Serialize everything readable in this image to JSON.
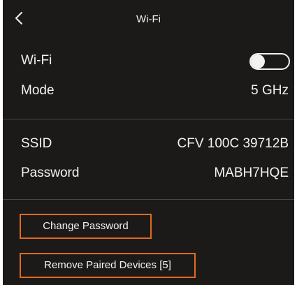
{
  "header": {
    "title": "Wi-Fi",
    "back_icon": "chevron-left-icon"
  },
  "wifi_section": {
    "wifi_label": "Wi-Fi",
    "wifi_enabled": false,
    "mode_label": "Mode",
    "mode_value": "5 GHz"
  },
  "network_section": {
    "ssid_label": "SSID",
    "ssid_value": "CFV 100C 39712B",
    "password_label": "Password",
    "password_value": "MABH7HQE"
  },
  "actions": {
    "change_password_label": "Change Password",
    "remove_devices_label": "Remove Paired Devices [5]"
  },
  "colors": {
    "background": "#1c1a19",
    "text": "#f2f2f2",
    "accent": "#e06a1c",
    "divider": "#4a4644"
  }
}
